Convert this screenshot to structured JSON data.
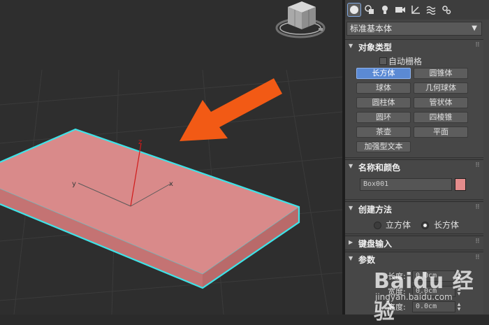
{
  "viewport": {
    "axis_labels": {
      "x": "x",
      "y": "y",
      "z": "z"
    },
    "colors": {
      "box_top": "#d98a8a",
      "box_side": "#c06e6e",
      "selection": "#3fe3e8",
      "arrow": "#f25a15",
      "grid": "#3b3b3b"
    }
  },
  "panel": {
    "tabs": [
      "create-geometry",
      "shapes",
      "lights",
      "cameras",
      "helpers",
      "space-warps",
      "systems"
    ],
    "dropdown": {
      "value": "标准基本体"
    },
    "object_type": {
      "title": "对象类型",
      "autogrid": "自动栅格",
      "buttons": [
        "长方体",
        "圆锥体",
        "球体",
        "几何球体",
        "圆柱体",
        "管状体",
        "圆环",
        "四棱锥",
        "茶壶",
        "平面",
        "加强型文本"
      ],
      "active": "长方体"
    },
    "name_color": {
      "title": "名称和颜色",
      "name_value": "Box001",
      "color": "#e48c8c"
    },
    "creation_method": {
      "title": "创建方法",
      "options": [
        "立方体",
        "长方体"
      ],
      "selected": "长方体"
    },
    "keyboard_entry": {
      "title": "键盘输入"
    },
    "parameters": {
      "title": "参数",
      "fields": [
        {
          "label": "长度:",
          "value": "0.0cm"
        },
        {
          "label": "宽度:",
          "value": "0.0cm"
        },
        {
          "label": "高度:",
          "value": "0.0cm"
        }
      ]
    }
  },
  "watermark": {
    "brand": "Baidu 经验",
    "url": "jingyan.baidu.com"
  }
}
